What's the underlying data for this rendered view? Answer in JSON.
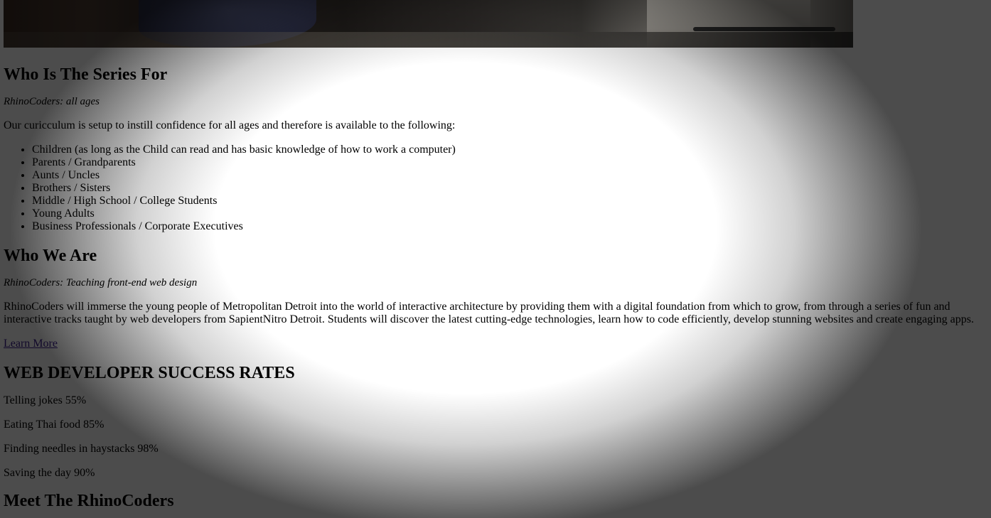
{
  "sections": {
    "series": {
      "heading": "Who Is The Series For",
      "tagline": "RhinoCoders: all ages",
      "intro": "Our curicculum is setup to instill confidence for all ages and therefore is available to the following:",
      "audience": [
        "Children (as long as the Child can read and has basic knowledge of how to work a computer)",
        "Parents / Grandparents",
        "Aunts / Uncles",
        "Brothers / Sisters",
        "Middle / High School / College Students",
        "Young Adults",
        "Business Professionals / Corporate Executives"
      ]
    },
    "who": {
      "heading": "Who We Are",
      "tagline": "RhinoCoders: Teaching front-end web design",
      "body": "RhinoCoders will immerse the young people of Metropolitan Detroit into the world of interactive architecture by providing them with a digital foundation from which to grow, from through a series of fun and interactive tracks taught by web developers from SapientNitro Detroit. Students will discover the latest cutting-edge technologies, learn how to code efficiently, develop stunning websites and create engaging apps.",
      "link_label": "Learn More"
    },
    "rates": {
      "heading": "WEB DEVELOPER SUCCESS RATES",
      "items": [
        "Telling jokes 55%",
        "Eating Thai food 85%",
        "Finding needles in haystacks 98%",
        "Saving the day 90%"
      ]
    },
    "meet": {
      "heading": "Meet The RhinoCoders"
    }
  },
  "colors": {
    "link": "#3a1e8c",
    "text": "#000000",
    "background": "#ffffff"
  }
}
